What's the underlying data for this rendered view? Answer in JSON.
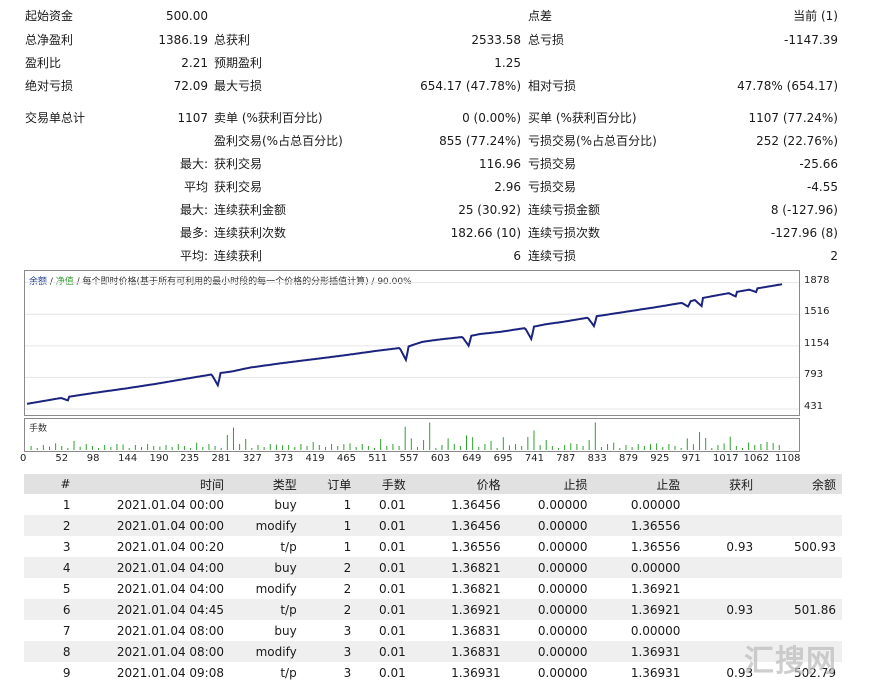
{
  "stats": {
    "row1": {
      "l1": "起始资金",
      "v1": "500.00",
      "l3": "点差",
      "v3": "当前 (1)"
    },
    "row2": {
      "l1": "总净盈利",
      "v1": "1386.19",
      "l2": "总获利",
      "v2": "2533.58",
      "l3": "总亏损",
      "v3": "-1147.39"
    },
    "row3": {
      "l1": "盈利比",
      "v1": "2.21",
      "l2": "预期盈利",
      "v2": "1.25"
    },
    "row4": {
      "l1": "绝对亏损",
      "v1": "72.09",
      "l2": "最大亏损",
      "v2": "654.17 (47.78%)",
      "l3": "相对亏损",
      "v3": "47.78% (654.17)"
    },
    "row5": {
      "l1": "交易单总计",
      "v1": "1107",
      "l2": "卖单 (%获利百分比)",
      "v2": "0 (0.00%)",
      "l3": "买单 (%获利百分比)",
      "v3": "1107 (77.24%)"
    },
    "row6": {
      "l2": "盈利交易(%占总百分比)",
      "v2": "855 (77.24%)",
      "l3": "亏损交易(%占总百分比)",
      "v3": "252 (22.76%)"
    },
    "row7": {
      "p": "最大:",
      "l2": "获利交易",
      "v2": "116.96",
      "l3": "亏损交易",
      "v3": "-25.66"
    },
    "row8": {
      "p": "平均",
      "l2": "获利交易",
      "v2": "2.96",
      "l3": "亏损交易",
      "v3": "-4.55"
    },
    "row9": {
      "p": "最大:",
      "l2": "连续获利金额",
      "v2": "25 (30.92)",
      "l3": "连续亏损金额",
      "v3": "8 (-127.96)"
    },
    "row10": {
      "p": "最多:",
      "l2": "连续获利次数",
      "v2": "182.66 (10)",
      "l3": "连续亏损次数",
      "v3": "-127.96 (8)"
    },
    "row11": {
      "p": "平均:",
      "l2": "连续获利",
      "v2": "6",
      "l3": "连续亏损",
      "v3": "2"
    }
  },
  "chart": {
    "legend_balance": "余额",
    "legend_sep1": " / ",
    "legend_equity": "净值",
    "legend_rest": " / 每个即时价格(基于所有可利用的最小时段的每一个价格的分形插值计算) / 90.00%",
    "volume_label": "手数",
    "y_ticks": [
      "1878",
      "1516",
      "1154",
      "793",
      "431"
    ],
    "x_ticks": [
      "0",
      "52",
      "98",
      "144",
      "190",
      "235",
      "281",
      "327",
      "373",
      "419",
      "465",
      "511",
      "557",
      "603",
      "649",
      "695",
      "741",
      "787",
      "833",
      "879",
      "925",
      "971",
      "1017",
      "1062",
      "1108"
    ],
    "line_color": "#1a237e",
    "volume_color": "#2ea02e"
  },
  "chart_data": {
    "type": "line",
    "x": [
      0,
      52,
      98,
      144,
      190,
      235,
      281,
      300,
      327,
      373,
      419,
      465,
      511,
      557,
      580,
      603,
      649,
      665,
      695,
      741,
      760,
      787,
      833,
      879,
      925,
      971,
      990,
      1017,
      1062,
      1108
    ],
    "values": [
      490,
      560,
      615,
      665,
      720,
      780,
      840,
      860,
      905,
      955,
      1000,
      1045,
      1095,
      1140,
      1200,
      1225,
      1265,
      1290,
      1315,
      1370,
      1400,
      1430,
      1490,
      1545,
      1600,
      1660,
      1700,
      1740,
      1800,
      1860
    ],
    "ylim": [
      431,
      1920
    ],
    "xlim": [
      0,
      1130
    ],
    "dips": [
      [
        60,
        40
      ],
      [
        281,
        150
      ],
      [
        557,
        160
      ],
      [
        649,
        120
      ],
      [
        741,
        150
      ],
      [
        833,
        120
      ],
      [
        971,
        60
      ],
      [
        990,
        90
      ],
      [
        1040,
        50
      ],
      [
        1070,
        40
      ]
    ]
  },
  "table": {
    "headers": [
      "#",
      "时间",
      "类型",
      "订单",
      "手数",
      "价格",
      "止损",
      "止盈",
      "获利",
      "余额"
    ],
    "rows": [
      [
        "1",
        "2021.01.04 00:00",
        "buy",
        "1",
        "0.01",
        "1.36456",
        "0.00000",
        "0.00000",
        "",
        ""
      ],
      [
        "2",
        "2021.01.04 00:00",
        "modify",
        "1",
        "0.01",
        "1.36456",
        "0.00000",
        "1.36556",
        "",
        ""
      ],
      [
        "3",
        "2021.01.04 00:20",
        "t/p",
        "1",
        "0.01",
        "1.36556",
        "0.00000",
        "1.36556",
        "0.93",
        "500.93"
      ],
      [
        "4",
        "2021.01.04 04:00",
        "buy",
        "2",
        "0.01",
        "1.36821",
        "0.00000",
        "0.00000",
        "",
        ""
      ],
      [
        "5",
        "2021.01.04 04:00",
        "modify",
        "2",
        "0.01",
        "1.36821",
        "0.00000",
        "1.36921",
        "",
        ""
      ],
      [
        "6",
        "2021.01.04 04:45",
        "t/p",
        "2",
        "0.01",
        "1.36921",
        "0.00000",
        "1.36921",
        "0.93",
        "501.86"
      ],
      [
        "7",
        "2021.01.04 08:00",
        "buy",
        "3",
        "0.01",
        "1.36831",
        "0.00000",
        "0.00000",
        "",
        ""
      ],
      [
        "8",
        "2021.01.04 08:00",
        "modify",
        "3",
        "0.01",
        "1.36831",
        "0.00000",
        "1.36931",
        "",
        ""
      ],
      [
        "9",
        "2021.01.04 09:08",
        "t/p",
        "3",
        "0.01",
        "1.36931",
        "0.00000",
        "1.36931",
        "0.93",
        "502.79"
      ]
    ]
  },
  "watermark": "汇搜网"
}
